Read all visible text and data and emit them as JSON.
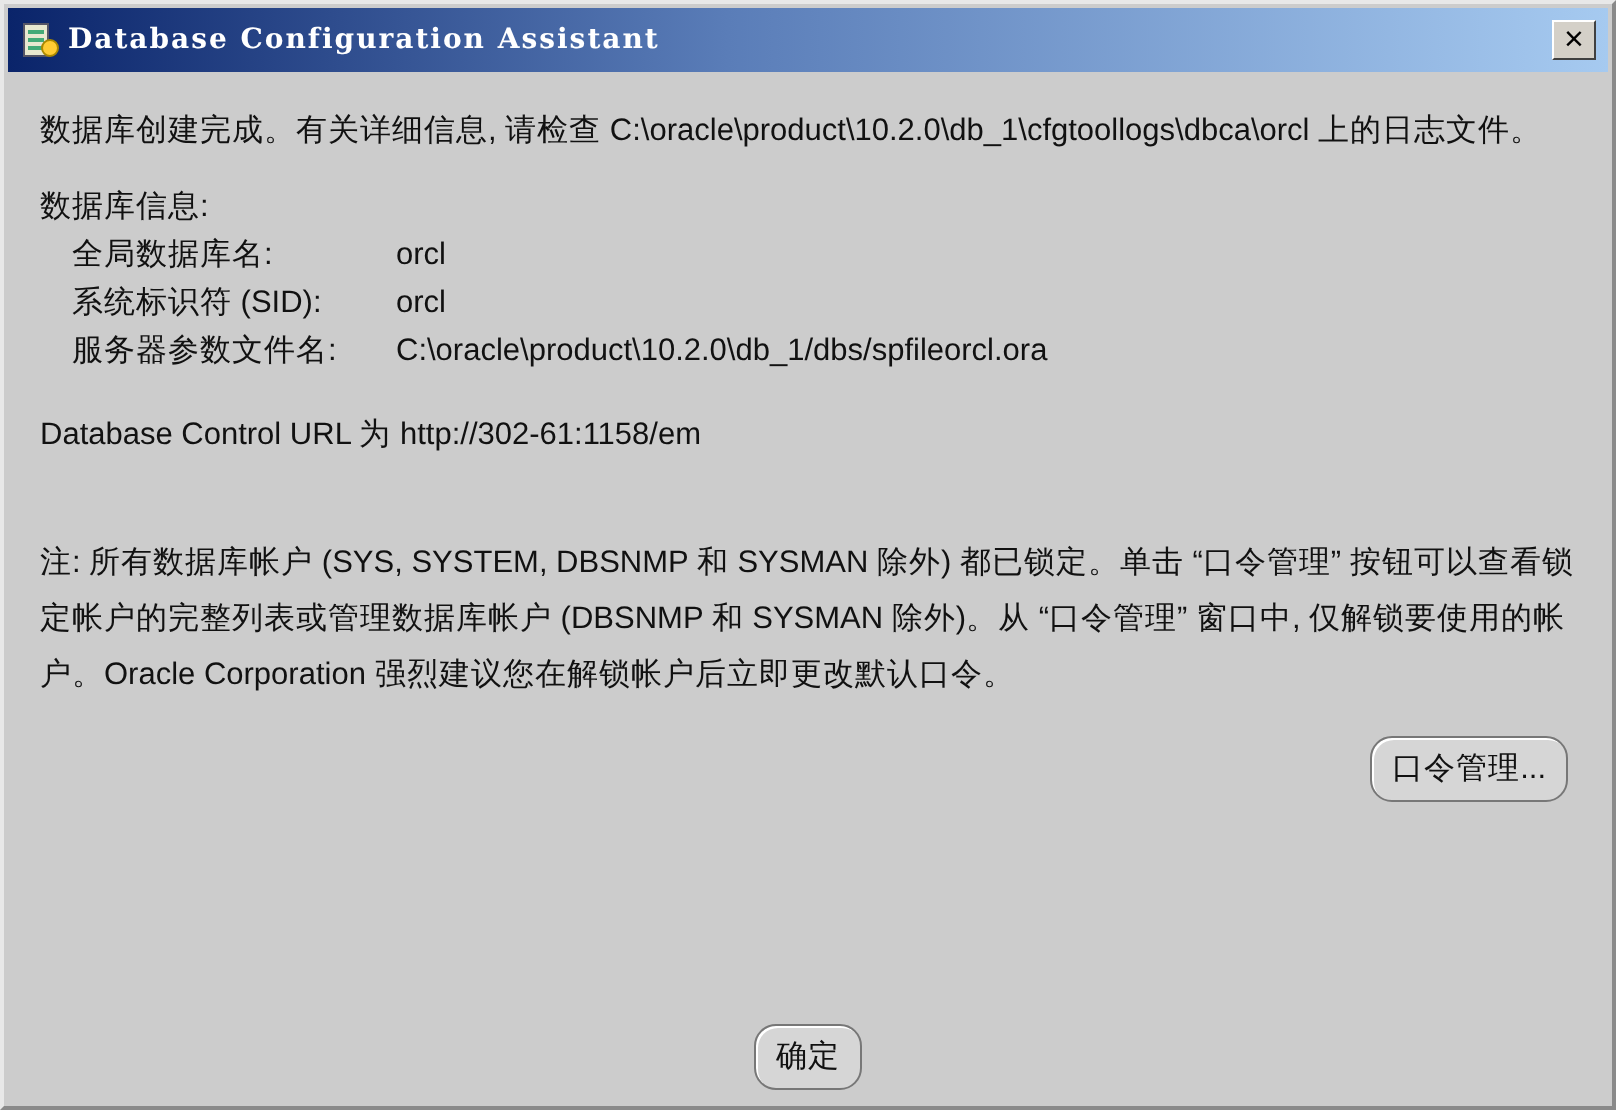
{
  "window": {
    "title": "Database Configuration Assistant",
    "close": "×"
  },
  "message": "数据库创建完成。有关详细信息, 请检查 C:\\oracle\\product\\10.2.0\\db_1\\cfgtoollogs\\dbca\\orcl 上的日志文件。",
  "info": {
    "heading": "数据库信息:",
    "fields": [
      {
        "label": "全局数据库名:",
        "value": "orcl"
      },
      {
        "label": "系统标识符 (SID):",
        "value": "orcl"
      },
      {
        "label": "服务器参数文件名:",
        "value": "C:\\oracle\\product\\10.2.0\\db_1/dbs/spfileorcl.ora"
      }
    ]
  },
  "url_line": "Database Control URL 为 http://302-61:1158/em",
  "note": "注: 所有数据库帐户 (SYS, SYSTEM, DBSNMP 和 SYSMAN 除外) 都已锁定。单击 “口令管理” 按钮可以查看锁定帐户的完整列表或管理数据库帐户 (DBSNMP 和 SYSMAN 除外)。从 “口令管理” 窗口中, 仅解锁要使用的帐户。Oracle Corporation 强烈建议您在解锁帐户后立即更改默认口令。",
  "buttons": [
    {
      "label": "口令管理...",
      "kind": "password"
    },
    {
      "label": "确定",
      "kind": "ok"
    }
  ]
}
